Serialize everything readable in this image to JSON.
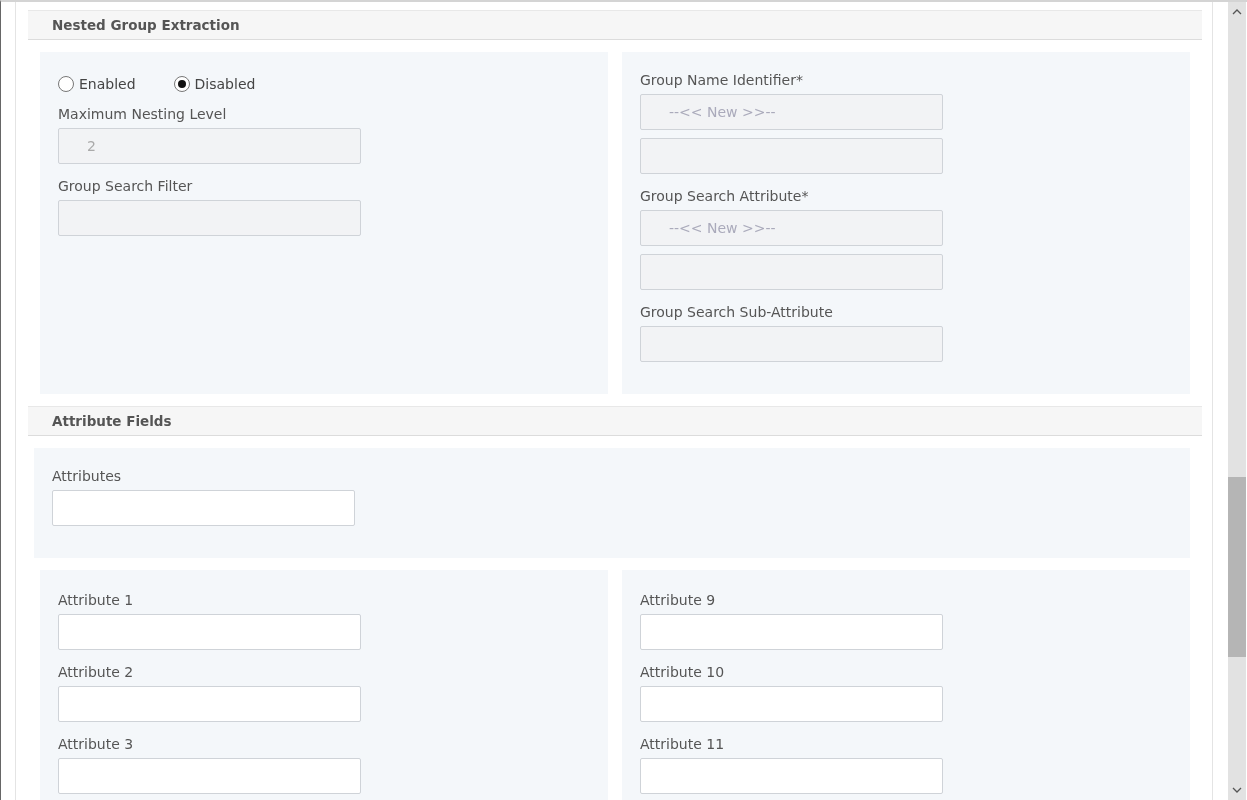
{
  "nested_group_extraction": {
    "title": "Nested Group Extraction",
    "radios": [
      {
        "label": "Enabled",
        "selected": false
      },
      {
        "label": "Disabled",
        "selected": true
      }
    ],
    "left_fields": [
      {
        "label": "Maximum Nesting Level",
        "value": "2",
        "disabled": true
      },
      {
        "label": "Group Search Filter",
        "disabled": true
      }
    ],
    "right_fields": [
      {
        "label": "Group Name Identifier*",
        "placeholder": "--<< New >>--",
        "disabled": true,
        "extra_field": true
      },
      {
        "label": "Group Search Attribute*",
        "placeholder": "--<< New >>--",
        "disabled": true,
        "extra_field": true
      },
      {
        "label": "Group Search Sub-Attribute",
        "disabled": true,
        "extra_field": false
      }
    ]
  },
  "attribute_fields": {
    "title": "Attribute Fields",
    "attributes": {
      "label": "Attributes",
      "disabled": false
    },
    "left_fields": [
      {
        "label": "Attribute 1",
        "disabled": false
      },
      {
        "label": "Attribute 2",
        "disabled": false
      },
      {
        "label": "Attribute 3",
        "disabled": false
      }
    ],
    "right_fields": [
      {
        "label": "Attribute 9",
        "disabled": false
      },
      {
        "label": "Attribute 10",
        "disabled": false
      },
      {
        "label": "Attribute 11",
        "disabled": false
      }
    ]
  }
}
